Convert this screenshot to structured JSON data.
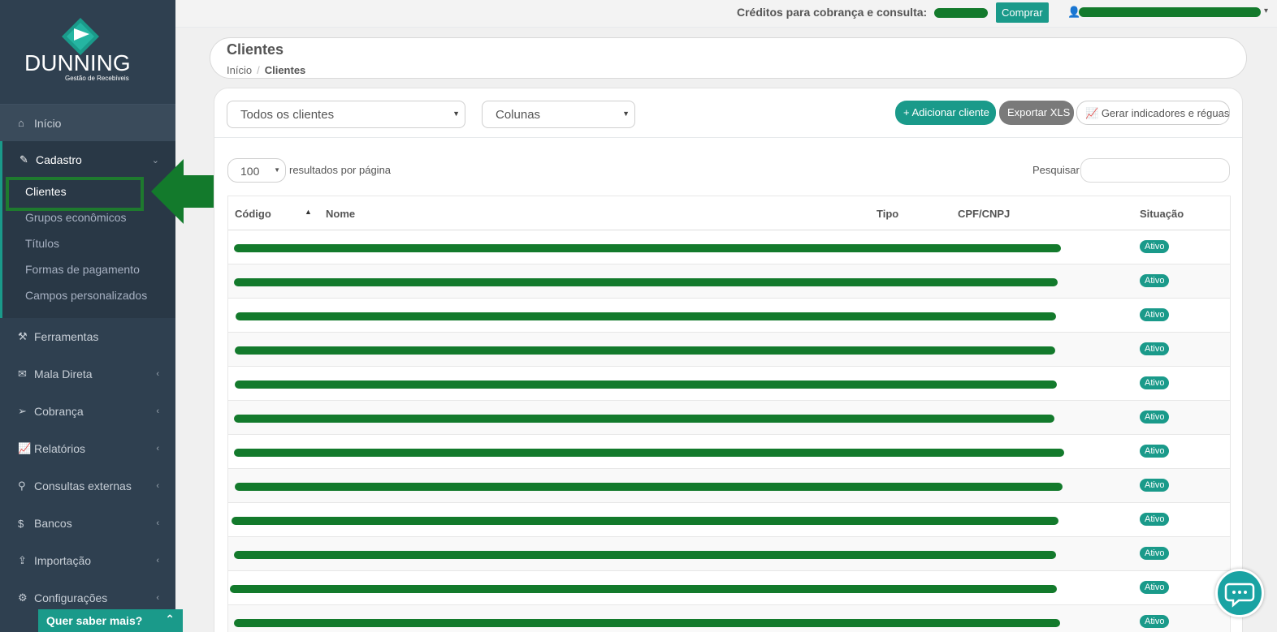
{
  "brand": {
    "name": "DUNNING",
    "tagline": "Gestão de Recebíveis"
  },
  "topbar": {
    "credits_label": "Créditos para cobrança e consulta:",
    "buy_label": "Comprar"
  },
  "sidebar": {
    "home": "Início",
    "cadastro": "Cadastro",
    "cadastro_items": [
      "Clientes",
      "Grupos econômicos",
      "Títulos",
      "Formas de pagamento",
      "Campos personalizados"
    ],
    "items": [
      "Ferramentas",
      "Mala Direta",
      "Cobrança",
      "Relatórios",
      "Consultas externas",
      "Bancos",
      "Importação",
      "Configurações"
    ],
    "promo": "Quer saber mais?"
  },
  "page": {
    "title": "Clientes",
    "breadcrumb_home": "Início",
    "breadcrumb_current": "Clientes"
  },
  "toolbar": {
    "filter_select": "Todos os clientes",
    "columns_select": "Colunas",
    "add_label": "+ Adicionar cliente",
    "export_label": "Exportar XLS",
    "indicators_label": "Gerar indicadores e réguas"
  },
  "list": {
    "per_page_value": "100",
    "per_page_label": "resultados por página",
    "search_label": "Pesquisar"
  },
  "table": {
    "headers": [
      "Código",
      "Nome",
      "Tipo",
      "CPF/CNPJ",
      "Situação"
    ],
    "status": [
      "Ativo",
      "Ativo",
      "Ativo",
      "Ativo",
      "Ativo",
      "Ativo",
      "Ativo",
      "Ativo",
      "Ativo",
      "Ativo",
      "Ativo",
      "Ativo"
    ]
  }
}
